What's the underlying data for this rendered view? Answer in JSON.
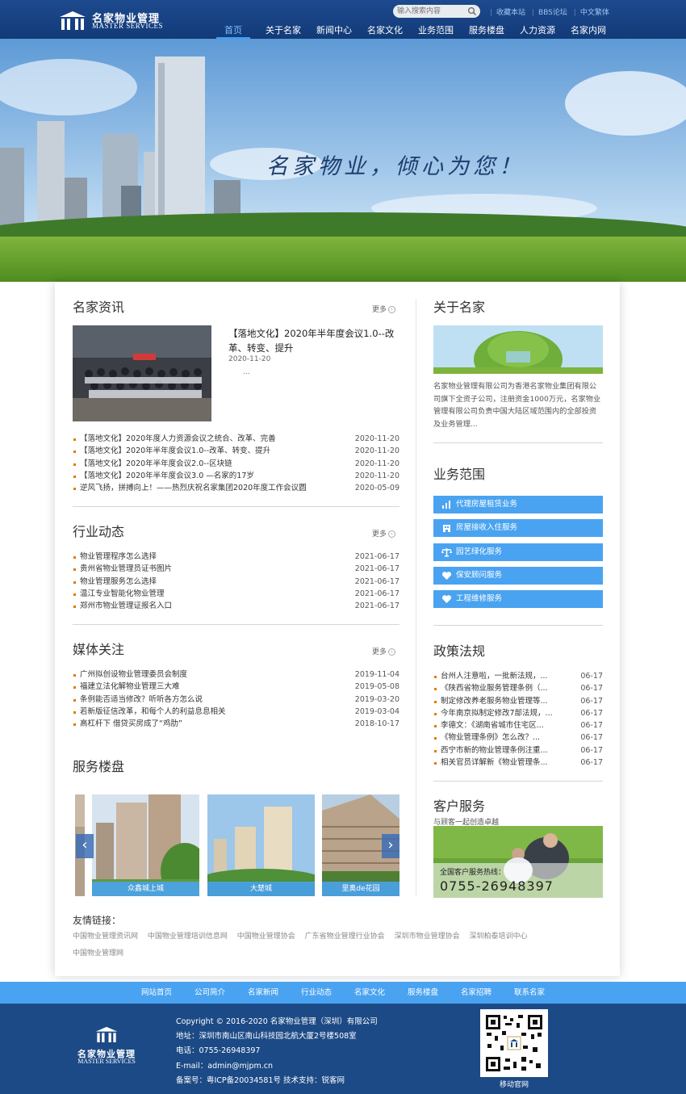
{
  "header": {
    "logo_cn": "名家物业管理",
    "logo_en": "MASTER SERVICES",
    "search_placeholder": "输入搜索内容",
    "links": [
      "收藏本站",
      "BBS论坛",
      "中文繁体"
    ],
    "nav": [
      "首页",
      "关于名家",
      "新闻中心",
      "名家文化",
      "业务范围",
      "服务楼盘",
      "人力资源",
      "名家内网"
    ],
    "colors": {
      "bar": "#1d4a8e",
      "accent": "#3aa0ff"
    }
  },
  "banner": {
    "slogan": "名家物业，倾心为您！",
    "slides": 4,
    "active_slide": 1
  },
  "news": {
    "title": "名家资讯",
    "more": "更多",
    "featured": {
      "title": "【落地文化】2020年半年度会议1.0--改革、转变、提升",
      "date": "2020-11-20",
      "summary": "..."
    },
    "items": [
      {
        "title": "【落地文化】2020年度人力资源会议之统合、改革、完善",
        "date": "2020-11-20"
      },
      {
        "title": "【落地文化】2020年半年度会议1.0--改革、转变、提升",
        "date": "2020-11-20"
      },
      {
        "title": "【落地文化】2020年半年度会议2.0--区块链",
        "date": "2020-11-20"
      },
      {
        "title": "【落地文化】2020年半年度会议3.0 —名家的17岁",
        "date": "2020-11-20"
      },
      {
        "title": "逆风飞扬，拼搏向上！——热烈庆祝名家集团2020年度工作会议圆",
        "date": "2020-05-09"
      }
    ]
  },
  "industry": {
    "title": "行业动态",
    "more": "更多",
    "items": [
      {
        "title": "物业管理程序怎么选择",
        "date": "2021-06-17"
      },
      {
        "title": "贵州省物业管理员证书图片",
        "date": "2021-06-17"
      },
      {
        "title": "物业管理服务怎么选择",
        "date": "2021-06-17"
      },
      {
        "title": "温江专业智能化物业管理",
        "date": "2021-06-17"
      },
      {
        "title": "郑州市物业管理证报名入口",
        "date": "2021-06-17"
      }
    ]
  },
  "media": {
    "title": "媒体关注",
    "more": "更多",
    "items": [
      {
        "title": "广州拟创设物业管理委员会制度",
        "date": "2019-11-04"
      },
      {
        "title": "福建立法化解物业管理三大难",
        "date": "2019-05-08"
      },
      {
        "title": "条例能否适当修改？听听各方怎么说",
        "date": "2019-03-20"
      },
      {
        "title": "若新版征信改革，和每个人的利益息息相关",
        "date": "2019-03-04"
      },
      {
        "title": "高杠杆下 借贷买房成了“鸡肋”",
        "date": "2018-10-17"
      }
    ]
  },
  "properties": {
    "title": "服务楼盘",
    "items": [
      {
        "name": "众鑫城上城"
      },
      {
        "name": "大楚城"
      },
      {
        "name": "里奥de花园"
      }
    ]
  },
  "about": {
    "title": "关于名家",
    "text": "名家物业管理有限公司为香港名家物业集团有限公司旗下全资子公司，注册资金1000万元，名家物业管理有限公司负责中国大陆区域范围内的全部投资及业务管理..."
  },
  "business": {
    "title": "业务范围",
    "items": [
      {
        "label": "代理房屋租赁业务",
        "icon": "chart-icon"
      },
      {
        "label": "房屋接收入住服务",
        "icon": "building-icon"
      },
      {
        "label": "园艺绿化服务",
        "icon": "scale-icon"
      },
      {
        "label": "保安顾问服务",
        "icon": "heart-icon"
      },
      {
        "label": "工程维修服务",
        "icon": "heart-icon"
      }
    ]
  },
  "policy": {
    "title": "政策法规",
    "items": [
      {
        "title": "台州人注意啦，一批新法规，...",
        "date": "06-17"
      },
      {
        "title": "《陕西省物业服务管理条例（...",
        "date": "06-17"
      },
      {
        "title": "制定修改养老服务物业管理等...",
        "date": "06-17"
      },
      {
        "title": "今年南京拟制定修改7部法规，...",
        "date": "06-17"
      },
      {
        "title": "李德文：《湖南省城市住宅区...",
        "date": "06-17"
      },
      {
        "title": "《物业管理条例》怎么改？...",
        "date": "06-17"
      },
      {
        "title": "西宁市新的物业管理条例注重...",
        "date": "06-17"
      },
      {
        "title": "相关官员详解新《物业管理条...",
        "date": "06-17"
      }
    ]
  },
  "service": {
    "title": "客户服务",
    "subtitle": "与顾客一起创造卓越",
    "hotline_label": "全国客户服务热线：",
    "hotline": "0755-26948397"
  },
  "friends": {
    "title": "友情链接：",
    "links": [
      "中国物业管理资讯网",
      "中国物业管理培训信息网",
      "中国物业管理协会",
      "广东省物业管理行业协会",
      "深圳市物业管理协会",
      "深圳柏泰培训中心",
      "中国物业管理网"
    ]
  },
  "footer": {
    "nav": [
      "网站首页",
      "公司简介",
      "名家新闻",
      "行业动态",
      "名家文化",
      "服务楼盘",
      "名家招聘",
      "联系名家"
    ],
    "logo_cn": "名家物业管理",
    "logo_en": "MASTER SERVICES",
    "copyright": "Copyright © 2016-2020 名家物业管理（深圳）有限公司",
    "address": "地址：深圳市南山区南山科技园北航大厦2号楼508室",
    "phone": "电话：0755-26948397",
    "email": "E-mail：admin@mjpm.cn",
    "icp": "备案号：粤ICP备20034581号  技术支持：锐客网",
    "qr_caption": "移动官网"
  }
}
